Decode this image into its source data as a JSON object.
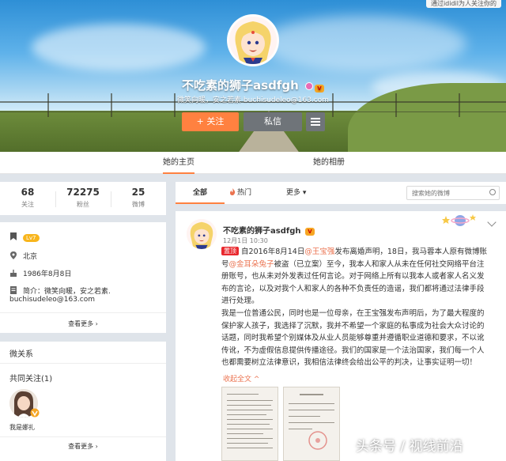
{
  "top_tip": "通过ididil为人关注你的",
  "profile": {
    "name": "不吃素的狮子asdfgh",
    "vip_badge": "V",
    "desc": "微笑向暖，安之若素 buchisudeleo@163.com",
    "follow_label": "+ 关注",
    "message_label": "私信"
  },
  "tabs": {
    "home": "她的主页",
    "album": "她的相册"
  },
  "stats": [
    {
      "num": "68",
      "label": "关注"
    },
    {
      "num": "72275",
      "label": "粉丝"
    },
    {
      "num": "25",
      "label": "微博"
    }
  ],
  "info": {
    "level": "Lv7",
    "location": "北京",
    "birthday": "1986年8月8日",
    "intro_line1": "简介：微笑向暖，安之若素.",
    "intro_line2": "buchisudeleo@163.com",
    "more": "查看更多 ›"
  },
  "relations": {
    "title": "微关系",
    "mutual": "共同关注(1)",
    "friend_name": "我是娜扎",
    "more": "查看更多 ›"
  },
  "feed": {
    "tab_all": "全部",
    "tab_hot": "热门",
    "tab_more": "更多 ▾",
    "search_placeholder": "搜索她的微博"
  },
  "post": {
    "name": "不吃素的狮子asdfgh",
    "time": "12月1日 10:30",
    "tag": "置顶",
    "p1a": "自2016年8月14日",
    "mention1": "@王宝强",
    "p1b": "发布离婚声明，18日，我马蓉本人原有微博账号",
    "mention2": "@金耳朵兔子",
    "p1c": "被盗（已立案）至今，我本人和家人从未在任何社交网络平台注册账号，也从未对外发表过任何言论。对于网络上所有以我本人或者家人名义发布的言论，以及对我个人和家人的各种不负责任的造谣，我们都将通过法律手段进行处理。",
    "p2": "我是一位普通公民，同时也是一位母亲，在王宝强发布声明后，为了最大程度的保护家人孩子，我选择了沉默，我并不希望一个家庭的私事成为社会大众讨论的话题，同时我希望个别媒体及从业人员能够尊重并遵循职业道德和要求，不以讹传讹，不为虚假信息提供传播途径。我们的国家是一个法治国家，我们每一个人也都需要树立法律意识，我相信法律终会给出公平的判决，让事实证明一切！",
    "collapse": "收起全文 ^"
  },
  "watermark": "头条号 / 视线前沿"
}
